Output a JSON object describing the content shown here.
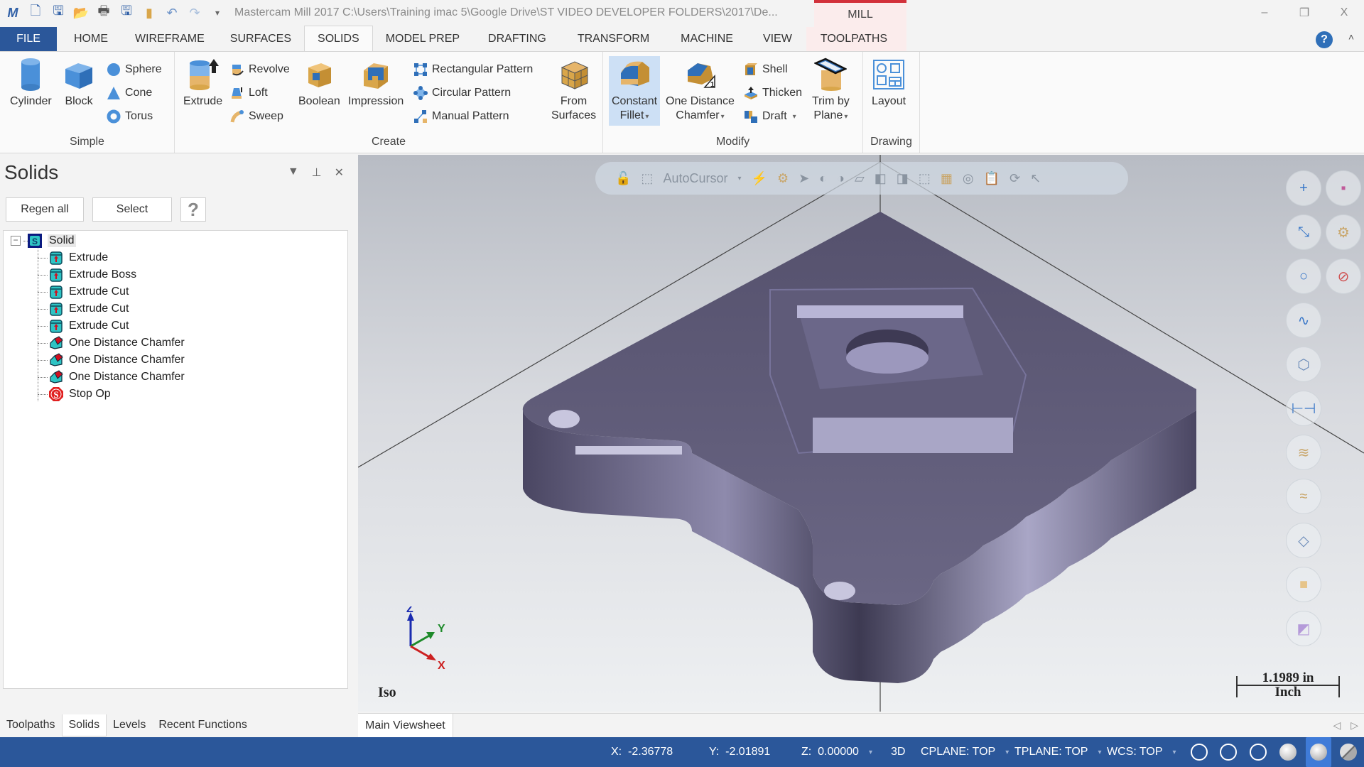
{
  "app": {
    "logo_text": "M",
    "title": "Mastercam Mill 2017  C:\\Users\\Training imac 5\\Google Drive\\ST VIDEO DEVELOPER FOLDERS\\2017\\De...",
    "context_tab": "MILL",
    "window_controls": {
      "minimize": "–",
      "restore": "❐",
      "close": "X"
    }
  },
  "quick_access": [
    "new-file",
    "save",
    "open",
    "print",
    "save-as",
    "folder",
    "undo",
    "redo",
    "customize"
  ],
  "tabs": [
    {
      "label": "FILE"
    },
    {
      "label": "HOME"
    },
    {
      "label": "WIREFRAME"
    },
    {
      "label": "SURFACES"
    },
    {
      "label": "SOLIDS",
      "active": true
    },
    {
      "label": "MODEL PREP"
    },
    {
      "label": "DRAFTING"
    },
    {
      "label": "TRANSFORM"
    },
    {
      "label": "MACHINE"
    },
    {
      "label": "VIEW"
    },
    {
      "label": "TOOLPATHS"
    }
  ],
  "ribbon": {
    "simple": {
      "label": "Simple",
      "cylinder": "Cylinder",
      "block": "Block",
      "sphere": "Sphere",
      "cone": "Cone",
      "torus": "Torus"
    },
    "create": {
      "label": "Create",
      "extrude": "Extrude",
      "revolve": "Revolve",
      "loft": "Loft",
      "sweep": "Sweep",
      "boolean": "Boolean",
      "impression": "Impression",
      "rectangular_pattern": "Rectangular Pattern",
      "circular_pattern": "Circular Pattern",
      "manual_pattern": "Manual Pattern",
      "from_surfaces_1": "From",
      "from_surfaces_2": "Surfaces"
    },
    "modify": {
      "label": "Modify",
      "constant_fillet_1": "Constant",
      "constant_fillet_2": "Fillet",
      "one_distance_chamfer_1": "One Distance",
      "one_distance_chamfer_2": "Chamfer",
      "shell": "Shell",
      "thicken": "Thicken",
      "draft": "Draft",
      "trim_by_plane_1": "Trim by",
      "trim_by_plane_2": "Plane"
    },
    "drawing": {
      "label": "Drawing",
      "layout": "Layout"
    }
  },
  "solids_panel": {
    "title": "Solids",
    "regen_all": "Regen all",
    "select": "Select",
    "help": "?",
    "tree": {
      "root": "Solid",
      "children": [
        {
          "label": "Extrude",
          "icon": "extrude"
        },
        {
          "label": "Extrude Boss",
          "icon": "extrude"
        },
        {
          "label": "Extrude Cut",
          "icon": "extrude"
        },
        {
          "label": "Extrude Cut",
          "icon": "extrude"
        },
        {
          "label": "Extrude Cut",
          "icon": "extrude"
        },
        {
          "label": "One Distance Chamfer",
          "icon": "chamfer"
        },
        {
          "label": "One Distance Chamfer",
          "icon": "chamfer"
        },
        {
          "label": "One Distance Chamfer",
          "icon": "chamfer"
        },
        {
          "label": "Stop Op",
          "icon": "stop"
        }
      ]
    }
  },
  "bottom_tabs": [
    {
      "label": "Toolpaths"
    },
    {
      "label": "Solids",
      "active": true
    },
    {
      "label": "Levels"
    },
    {
      "label": "Recent Functions"
    }
  ],
  "viewport": {
    "toolbar_autocursor": "AutoCursor",
    "view_name": "Iso",
    "axis": {
      "x": "X",
      "y": "Y",
      "z": "Z"
    },
    "scale_value": "1.1989 in",
    "scale_unit": "Inch"
  },
  "viewsheet": {
    "tab": "Main Viewsheet"
  },
  "status": {
    "x_label": "X:",
    "x": "-2.36778",
    "y_label": "Y:",
    "y": "-2.01891",
    "z_label": "Z:",
    "z": "0.00000",
    "mode": "3D",
    "cplane": "CPLANE: TOP",
    "tplane": "TPLANE: TOP",
    "wcs": "WCS: TOP"
  },
  "colors": {
    "accent": "#2b579a",
    "mill_context": "#d2303a",
    "part": "#5e5a78"
  }
}
